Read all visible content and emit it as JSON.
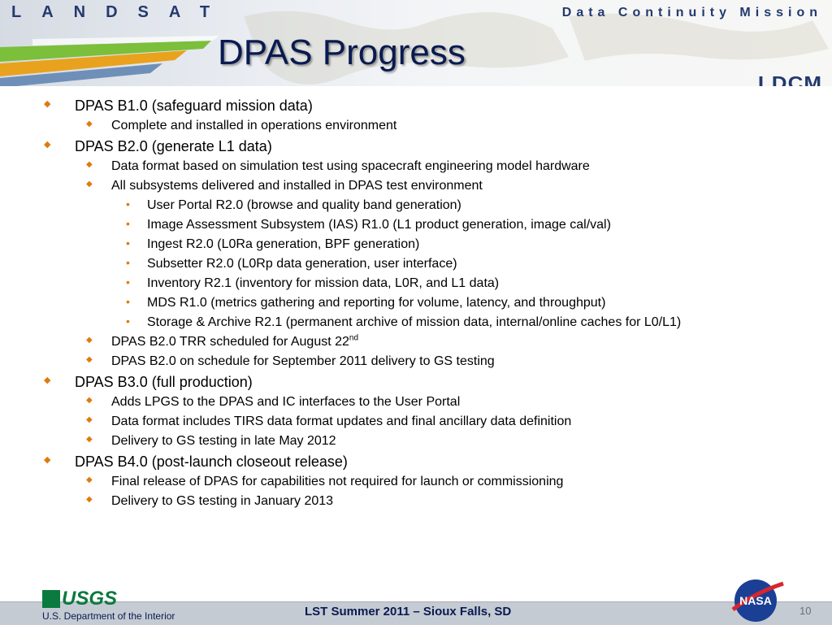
{
  "header": {
    "brand_left": "LANDSAT",
    "brand_right": "Data Continuity Mission",
    "title": "DPAS Progress",
    "mission_logo": "LDCM"
  },
  "bullets": [
    {
      "level": 1,
      "text": "DPAS B1.0 (safeguard mission data)"
    },
    {
      "level": 2,
      "text": "Complete and installed in operations environment"
    },
    {
      "level": 1,
      "text": "DPAS B2.0 (generate L1 data)"
    },
    {
      "level": 2,
      "text": "Data format based on simulation test using spacecraft engineering model hardware"
    },
    {
      "level": 2,
      "text": "All subsystems delivered and installed in DPAS test environment"
    },
    {
      "level": 3,
      "text": "User Portal R2.0 (browse and quality band generation)"
    },
    {
      "level": 3,
      "text": "Image Assessment Subsystem (IAS) R1.0 (L1 product generation, image cal/val)"
    },
    {
      "level": 3,
      "text": "Ingest R2.0 (L0Ra generation, BPF generation)"
    },
    {
      "level": 3,
      "text": "Subsetter R2.0 (L0Rp data generation, user interface)"
    },
    {
      "level": 3,
      "text": "Inventory R2.1 (inventory for mission data, L0R, and L1 data)"
    },
    {
      "level": 3,
      "text": "MDS R1.0 (metrics gathering and reporting for volume, latency, and throughput)"
    },
    {
      "level": 3,
      "text": "Storage & Archive R2.1 (permanent archive of mission data, internal/online caches for L0/L1)"
    },
    {
      "level": 2,
      "text": "DPAS B2.0 TRR scheduled for August 22",
      "sup": "nd"
    },
    {
      "level": 2,
      "text": "DPAS B2.0 on schedule for September 2011 delivery to GS testing"
    },
    {
      "level": 1,
      "text": "DPAS B3.0 (full production)"
    },
    {
      "level": 2,
      "text": "Adds LPGS to the DPAS and IC interfaces to the User Portal"
    },
    {
      "level": 2,
      "text": "Data format includes TIRS data format updates and final ancillary data definition"
    },
    {
      "level": 2,
      "text": "Delivery to GS testing in late May 2012"
    },
    {
      "level": 1,
      "text": "DPAS B4.0 (post-launch closeout release)"
    },
    {
      "level": 2,
      "text": "Final release of DPAS for capabilities not required for launch or commissioning"
    },
    {
      "level": 2,
      "text": "Delivery to GS testing in January 2013"
    }
  ],
  "footer": {
    "usgs_logo": "USGS",
    "department": "U.S. Department of the Interior",
    "conference": "LST Summer 2011 – Sioux Falls, SD",
    "slide_number": "10",
    "nasa_logo": "NASA"
  },
  "colors": {
    "bullet": "#e07a0b",
    "title": "#0a1a50",
    "brand": "#233a6e",
    "usgs_green": "#0b7a3e"
  }
}
